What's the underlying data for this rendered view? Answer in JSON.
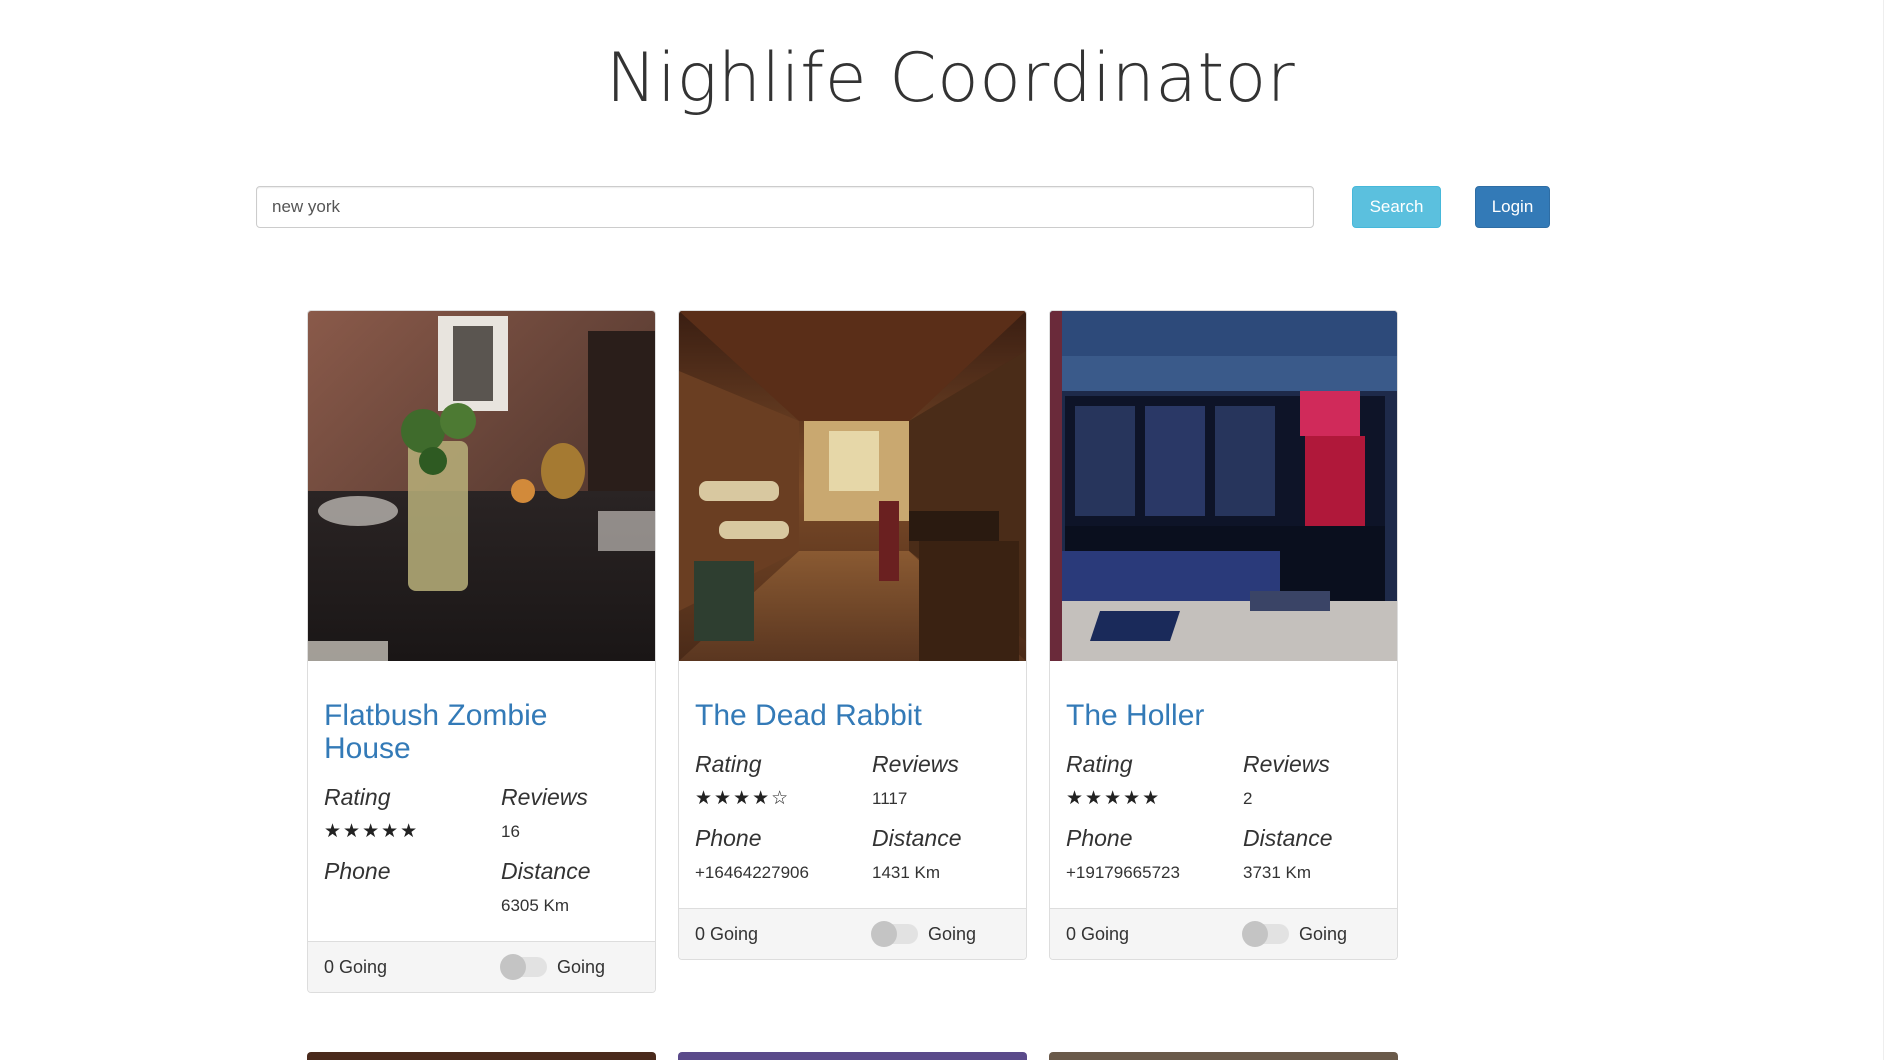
{
  "app": {
    "title": "Nighlife Coordinator"
  },
  "search": {
    "value": "new york",
    "button_label": "Search"
  },
  "login": {
    "label": "Login"
  },
  "labels": {
    "rating": "Rating",
    "reviews": "Reviews",
    "phone": "Phone",
    "distance": "Distance",
    "going_toggle": "Going"
  },
  "cards": [
    {
      "name": "Flatbush Zombie House",
      "rating_stars": "★★★★★",
      "rating": 5,
      "reviews": "16",
      "phone": "",
      "distance": "6305 Km",
      "going_count": "0 Going",
      "going": false
    },
    {
      "name": "The Dead Rabbit",
      "rating_stars": "★★★★☆",
      "rating": 4,
      "reviews": "1117",
      "phone": "+16464227906",
      "distance": "1431 Km",
      "going_count": "0 Going",
      "going": false
    },
    {
      "name": "The Holler",
      "rating_stars": "★★★★★",
      "rating": 5,
      "reviews": "2",
      "phone": "+19179665723",
      "distance": "3731 Km",
      "going_count": "0 Going",
      "going": false
    }
  ],
  "colors": {
    "link": "#337ab7",
    "search_btn": "#5bc0de",
    "login_btn": "#337ab7"
  }
}
